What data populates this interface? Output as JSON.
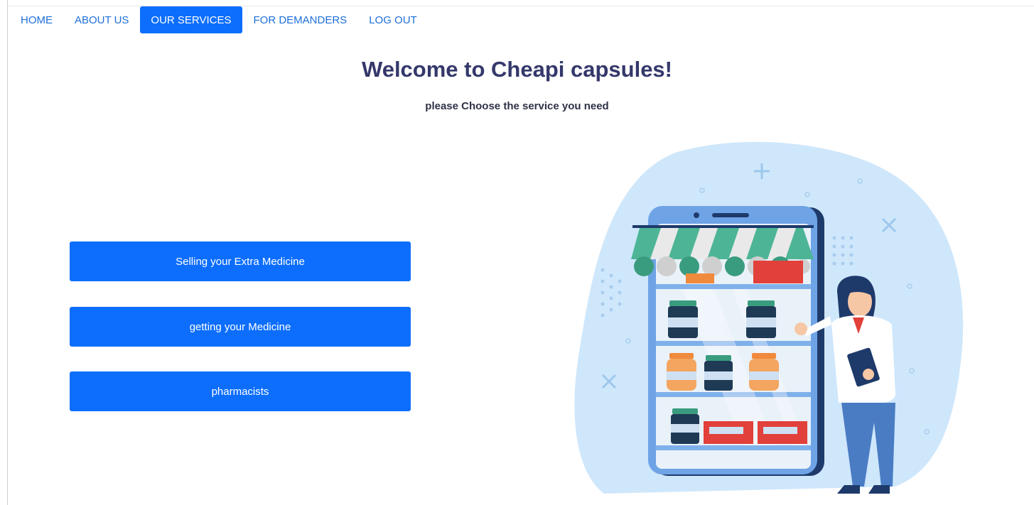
{
  "nav": {
    "items": [
      {
        "label": "HOME",
        "active": false
      },
      {
        "label": "ABOUT US",
        "active": false
      },
      {
        "label": "OUR SERVICES",
        "active": true
      },
      {
        "label": "FOR DEMANDERS",
        "active": false
      },
      {
        "label": "LOG OUT",
        "active": false
      }
    ]
  },
  "main": {
    "title": "Welcome to Cheapi capsules!",
    "subtitle": "please Choose the service you need",
    "buttons": [
      {
        "label": "Selling your Extra Medicine"
      },
      {
        "label": "getting your Medicine"
      },
      {
        "label": "pharmacists"
      }
    ]
  },
  "illustration": {
    "icon": "pharmacy-phone-illustration"
  },
  "colors": {
    "accent": "#0d6efd",
    "title": "#34386b",
    "blob": "#cfe7fb",
    "awning_green": "#4db596"
  }
}
